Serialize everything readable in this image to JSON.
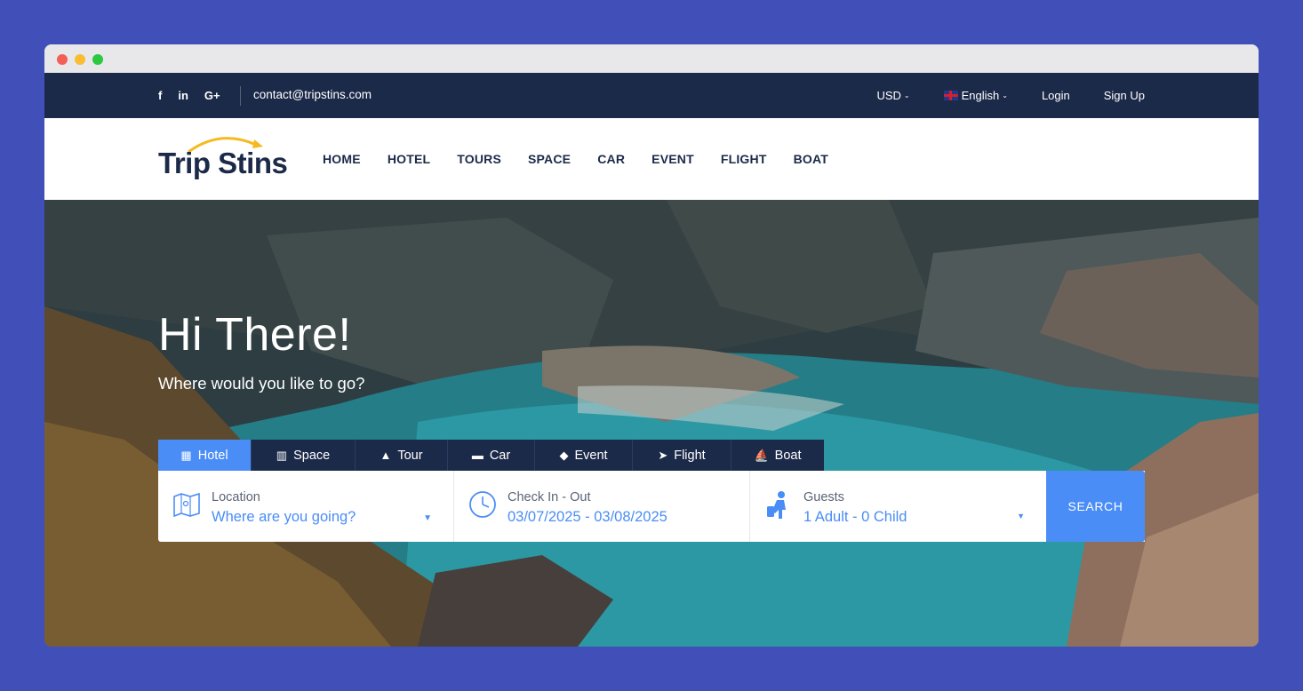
{
  "topbar": {
    "social": [
      "f",
      "in",
      "G+"
    ],
    "email": "contact@tripstins.com",
    "currency": "USD",
    "language": "English",
    "login": "Login",
    "signup": "Sign Up"
  },
  "brand": {
    "logo": "Trip Stins"
  },
  "nav": [
    "HOME",
    "HOTEL",
    "TOURS",
    "SPACE",
    "CAR",
    "EVENT",
    "FLIGHT",
    "BOAT"
  ],
  "hero": {
    "title": "Hi There!",
    "subtitle": "Where would you like to go?"
  },
  "tabs": [
    {
      "label": "Hotel",
      "icon": "hotel-icon",
      "active": true
    },
    {
      "label": "Space",
      "icon": "building-icon"
    },
    {
      "label": "Tour",
      "icon": "palm-tree-icon"
    },
    {
      "label": "Car",
      "icon": "car-icon"
    },
    {
      "label": "Event",
      "icon": "ticket-icon"
    },
    {
      "label": "Flight",
      "icon": "plane-icon"
    },
    {
      "label": "Boat",
      "icon": "ship-icon"
    }
  ],
  "search": {
    "location_label": "Location",
    "location_placeholder": "Where are you going?",
    "dates_label": "Check In - Out",
    "dates_value": "03/07/2025 - 03/08/2025",
    "guests_label": "Guests",
    "guests_value": "1 Adult - 0 Child",
    "button": "SEARCH"
  },
  "colors": {
    "background": "#4150b9",
    "navy": "#1c2a49",
    "accent": "#4a8df6",
    "logo_arc": "#f6b91f"
  }
}
